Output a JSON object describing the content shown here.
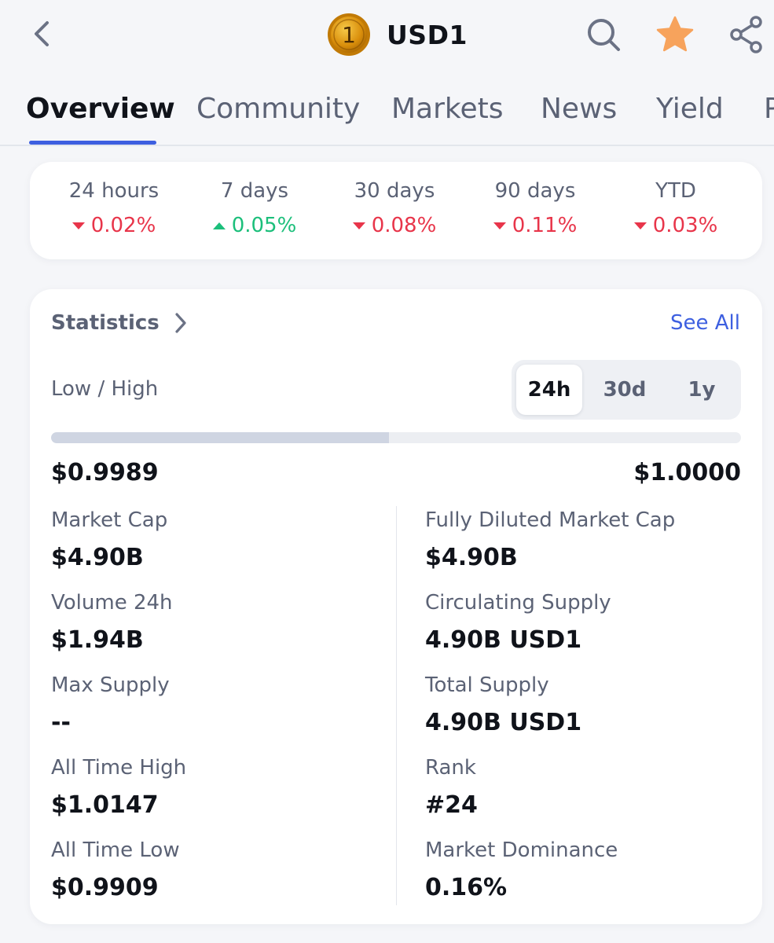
{
  "header": {
    "coin_symbol": "USD1",
    "coin_logo_glyph": "1",
    "icons": {
      "back": "chevron-left-icon",
      "search": "search-icon",
      "favorite": "star-icon",
      "share": "share-icon"
    },
    "favorite_color": "#f7a35c"
  },
  "tabs": [
    {
      "label": "Overview",
      "active": true
    },
    {
      "label": "Community"
    },
    {
      "label": "Markets"
    },
    {
      "label": "News"
    },
    {
      "label": "Yield"
    },
    {
      "label": "P"
    }
  ],
  "performance": [
    {
      "label": "24 hours",
      "change": "0.02%",
      "direction": "down"
    },
    {
      "label": "7 days",
      "change": "0.05%",
      "direction": "up"
    },
    {
      "label": "30 days",
      "change": "0.08%",
      "direction": "down"
    },
    {
      "label": "90 days",
      "change": "0.11%",
      "direction": "down"
    },
    {
      "label": "YTD",
      "change": "0.03%",
      "direction": "down"
    }
  ],
  "colors": {
    "negative": "#e8354a",
    "positive": "#1cbf7b",
    "accent": "#3d5fe0"
  },
  "statistics": {
    "title": "Statistics",
    "see_all": "See All",
    "low_high_label": "Low / High",
    "periods": [
      {
        "label": "24h",
        "active": true
      },
      {
        "label": "30d"
      },
      {
        "label": "1y"
      }
    ],
    "range_fill_fraction": 0.49,
    "low": "$0.9989",
    "high": "$1.0000",
    "left": [
      {
        "label": "Market Cap",
        "value": "$4.90B"
      },
      {
        "label": "Volume 24h",
        "value": "$1.94B"
      },
      {
        "label": "Max Supply",
        "value": "--"
      },
      {
        "label": "All Time High",
        "value": "$1.0147"
      },
      {
        "label": "All Time Low",
        "value": "$0.9909"
      }
    ],
    "right": [
      {
        "label": "Fully Diluted Market Cap",
        "value": "$4.90B"
      },
      {
        "label": "Circulating Supply",
        "value": "4.90B USD1"
      },
      {
        "label": "Total Supply",
        "value": "4.90B USD1"
      },
      {
        "label": "Rank",
        "value": "#24"
      },
      {
        "label": "Market Dominance",
        "value": "0.16%"
      }
    ]
  }
}
